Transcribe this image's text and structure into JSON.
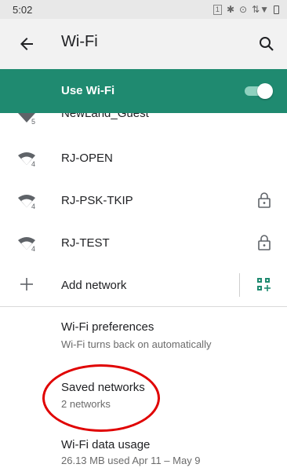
{
  "status_bar": {
    "time": "5:02",
    "sim_label": "1"
  },
  "app_bar": {
    "title": "Wi-Fi",
    "back_icon": "arrow-back-icon",
    "search_icon": "search-icon"
  },
  "use_wifi": {
    "label": "Use Wi-Fi",
    "enabled": true,
    "accent_color": "#1f8a70"
  },
  "networks": [
    {
      "ssid": "NewLand_Guest",
      "band": "5",
      "secured": false
    },
    {
      "ssid": "RJ-OPEN",
      "band": "4",
      "secured": false
    },
    {
      "ssid": "RJ-PSK-TKIP",
      "band": "4",
      "secured": true
    },
    {
      "ssid": "RJ-TEST",
      "band": "4",
      "secured": true
    }
  ],
  "add_network": {
    "label": "Add network",
    "icon": "plus-icon",
    "qr_icon": "qr-code-scan-icon"
  },
  "preferences": [
    {
      "title": "Wi-Fi preferences",
      "subtitle": "Wi-Fi turns back on automatically"
    },
    {
      "title": "Saved networks",
      "subtitle": "2 networks"
    },
    {
      "title": "Wi-Fi data usage",
      "subtitle": "26.13 MB used Apr 11 – May 9"
    }
  ],
  "annotation": {
    "highlight_color": "#e00000"
  }
}
